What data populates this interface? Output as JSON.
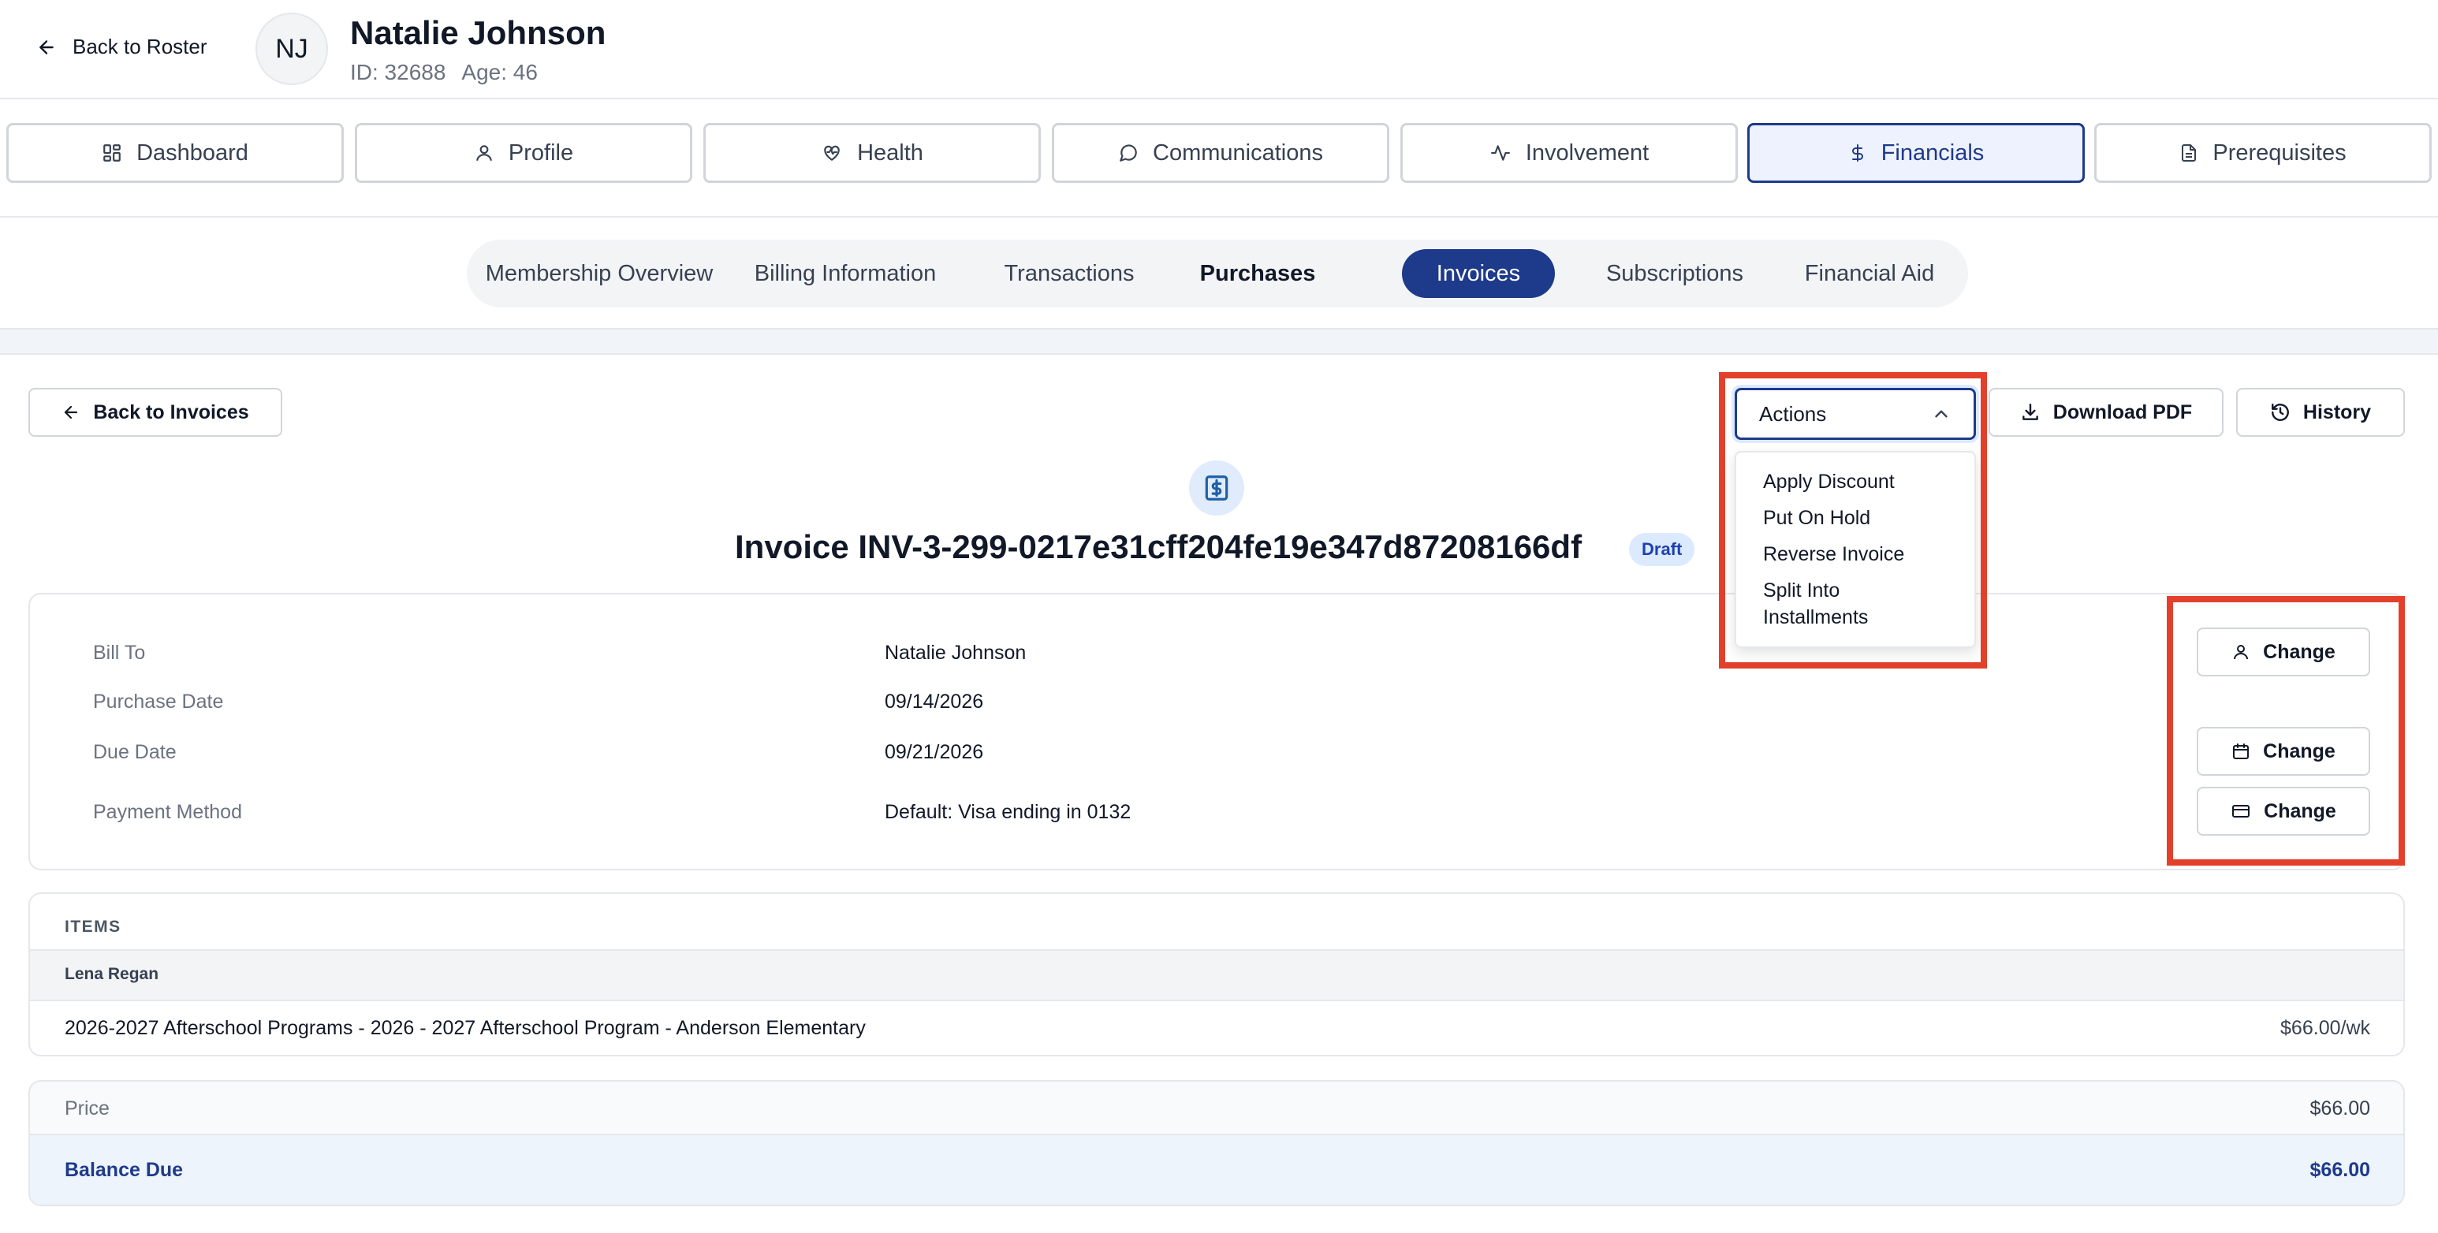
{
  "header": {
    "back_label": "Back to Roster",
    "avatar_initials": "NJ",
    "name": "Natalie Johnson",
    "id_text": "ID: 32688",
    "age_text": "Age: 46"
  },
  "main_tabs": [
    {
      "label": "Dashboard",
      "icon": "dashboard-grid-icon"
    },
    {
      "label": "Profile",
      "icon": "user-icon"
    },
    {
      "label": "Health",
      "icon": "heart-pulse-icon"
    },
    {
      "label": "Communications",
      "icon": "chat-bubble-icon"
    },
    {
      "label": "Involvement",
      "icon": "activity-icon"
    },
    {
      "label": "Financials",
      "icon": "dollar-icon",
      "active": true
    },
    {
      "label": "Prerequisites",
      "icon": "document-icon"
    }
  ],
  "sub_tabs": [
    {
      "label": "Membership Overview"
    },
    {
      "label": "Billing Information"
    },
    {
      "label": "Transactions"
    },
    {
      "label": "Purchases"
    },
    {
      "label": "Invoices",
      "active": true
    },
    {
      "label": "Subscriptions"
    },
    {
      "label": "Financial Aid"
    }
  ],
  "toolbar": {
    "back_label": "Back to Invoices",
    "actions_label": "Actions",
    "download_label": "Download PDF",
    "history_label": "History"
  },
  "actions_menu": [
    "Apply Discount",
    "Put On Hold",
    "Reverse Invoice",
    "Split Into Installments"
  ],
  "invoice": {
    "title": "Invoice INV-3-299-0217e31cff204fe19e347d87208166df",
    "status": "Draft"
  },
  "details": {
    "bill_to_label": "Bill To",
    "bill_to_value": "Natalie Johnson",
    "purchase_date_label": "Purchase Date",
    "purchase_date_value": "09/14/2026",
    "due_date_label": "Due Date",
    "due_date_value": "09/21/2026",
    "payment_method_label": "Payment Method",
    "payment_method_value": "Default: Visa ending in 0132",
    "change_label": "Change"
  },
  "items": {
    "heading": "ITEMS",
    "group_name": "Lena Regan",
    "rows": [
      {
        "description": "2026-2027 Afterschool Programs - 2026 - 2027 Afterschool Program - Anderson Elementary",
        "price": "$66.00/wk"
      }
    ]
  },
  "totals": {
    "price_label": "Price",
    "price_value": "$66.00",
    "balance_label": "Balance Due",
    "balance_value": "$66.00"
  },
  "colors": {
    "accent": "#1e3a8a",
    "highlight": "#e3402c",
    "badge_bg": "#dbeafe"
  }
}
